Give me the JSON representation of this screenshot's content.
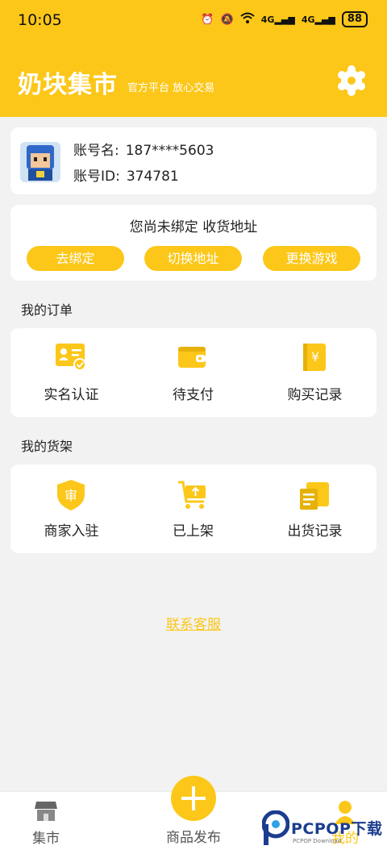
{
  "status_bar": {
    "time": "10:05",
    "net1": "4G",
    "net2": "4G",
    "battery": "88"
  },
  "header": {
    "title": "奶块集市",
    "subtitle": "官方平台 放心交易",
    "settings_icon": "gear-icon"
  },
  "account": {
    "name_label": "账号名:",
    "name_value": "187****5603",
    "id_label": "账号ID:",
    "id_value": "374781"
  },
  "address": {
    "notice": "您尚未绑定 收货地址",
    "buttons": [
      "去绑定",
      "切换地址",
      "更换游戏"
    ]
  },
  "orders": {
    "title": "我的订单",
    "items": [
      {
        "label": "实名认证",
        "icon": "id-card-icon"
      },
      {
        "label": "待支付",
        "icon": "wallet-icon"
      },
      {
        "label": "购买记录",
        "icon": "receipt-book-icon"
      }
    ]
  },
  "shelf": {
    "title": "我的货架",
    "items": [
      {
        "label": "商家入驻",
        "icon": "shield-audit-icon"
      },
      {
        "label": "已上架",
        "icon": "cart-upload-icon"
      },
      {
        "label": "出货记录",
        "icon": "package-doc-icon"
      }
    ]
  },
  "service_link": "联系客服",
  "bottom_nav": {
    "home": "集市",
    "publish": "商品发布",
    "me": "我的"
  },
  "watermark": {
    "text": "PCPOP下载",
    "sub": "PCPOP Download"
  },
  "colors": {
    "accent": "#fcc719",
    "background": "#f2f2f2"
  }
}
